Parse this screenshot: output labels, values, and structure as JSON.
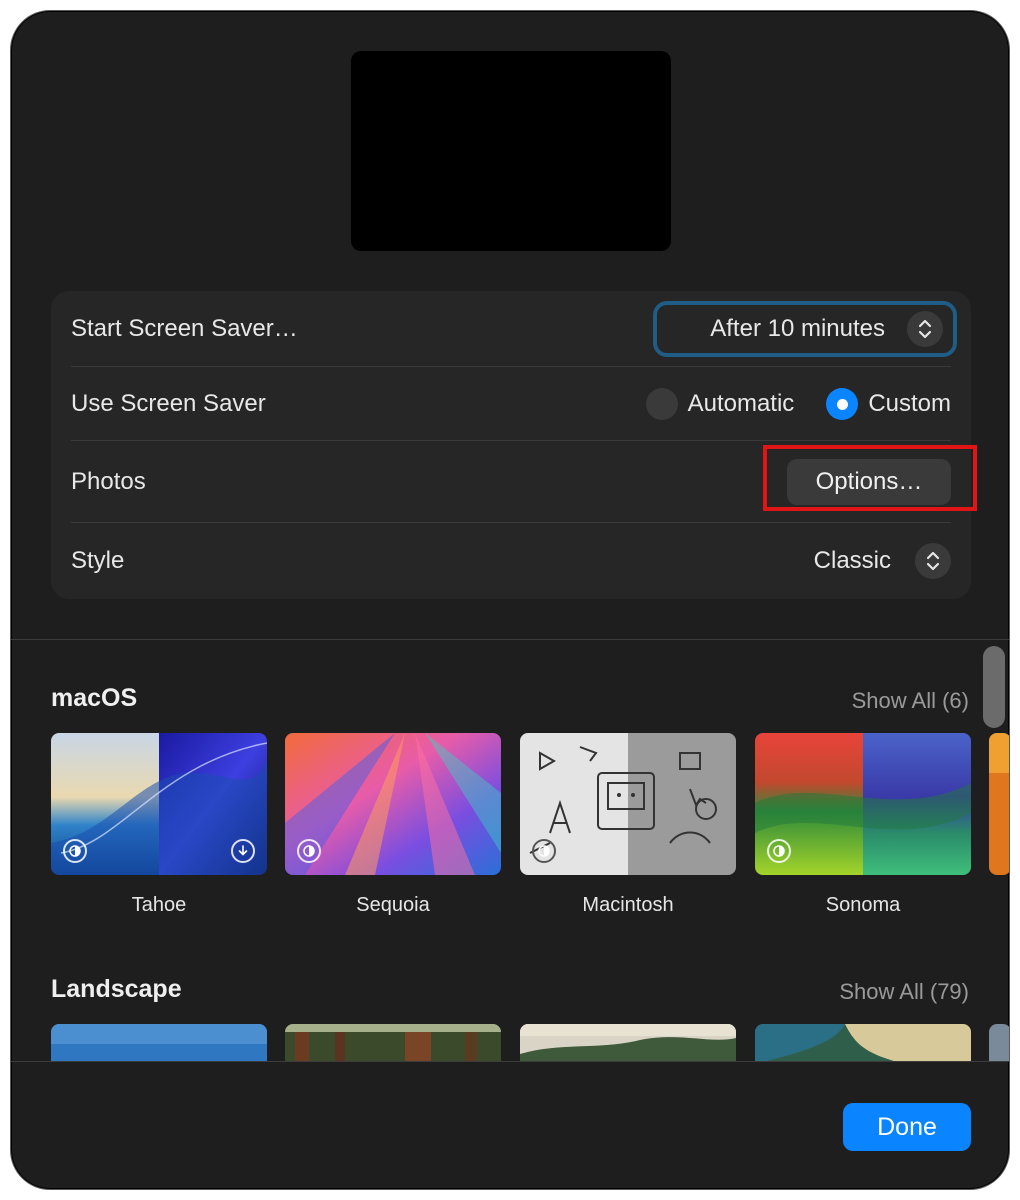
{
  "settings": {
    "start_label": "Start Screen Saver…",
    "start_value": "After 10 minutes",
    "use_label": "Use Screen Saver",
    "radio_automatic": "Automatic",
    "radio_custom": "Custom",
    "selected_radio": "Custom",
    "photos_label": "Photos",
    "options_button": "Options…",
    "style_label": "Style",
    "style_value": "Classic"
  },
  "sections": [
    {
      "title": "macOS",
      "show_all": "Show All (6)",
      "items": [
        {
          "label": "Tahoe",
          "badge": "appearance-icon",
          "extra_badge": "download-icon"
        },
        {
          "label": "Sequoia",
          "badge": "appearance-icon"
        },
        {
          "label": "Macintosh",
          "badge": "appearance-icon"
        },
        {
          "label": "Sonoma",
          "badge": "appearance-icon"
        }
      ]
    },
    {
      "title": "Landscape",
      "show_all": "Show All (79)"
    }
  ],
  "footer": {
    "done_button": "Done"
  },
  "colors": {
    "accent": "#0a84ff",
    "highlight_box": "#e01515",
    "focus_ring": "#1f5c86"
  }
}
